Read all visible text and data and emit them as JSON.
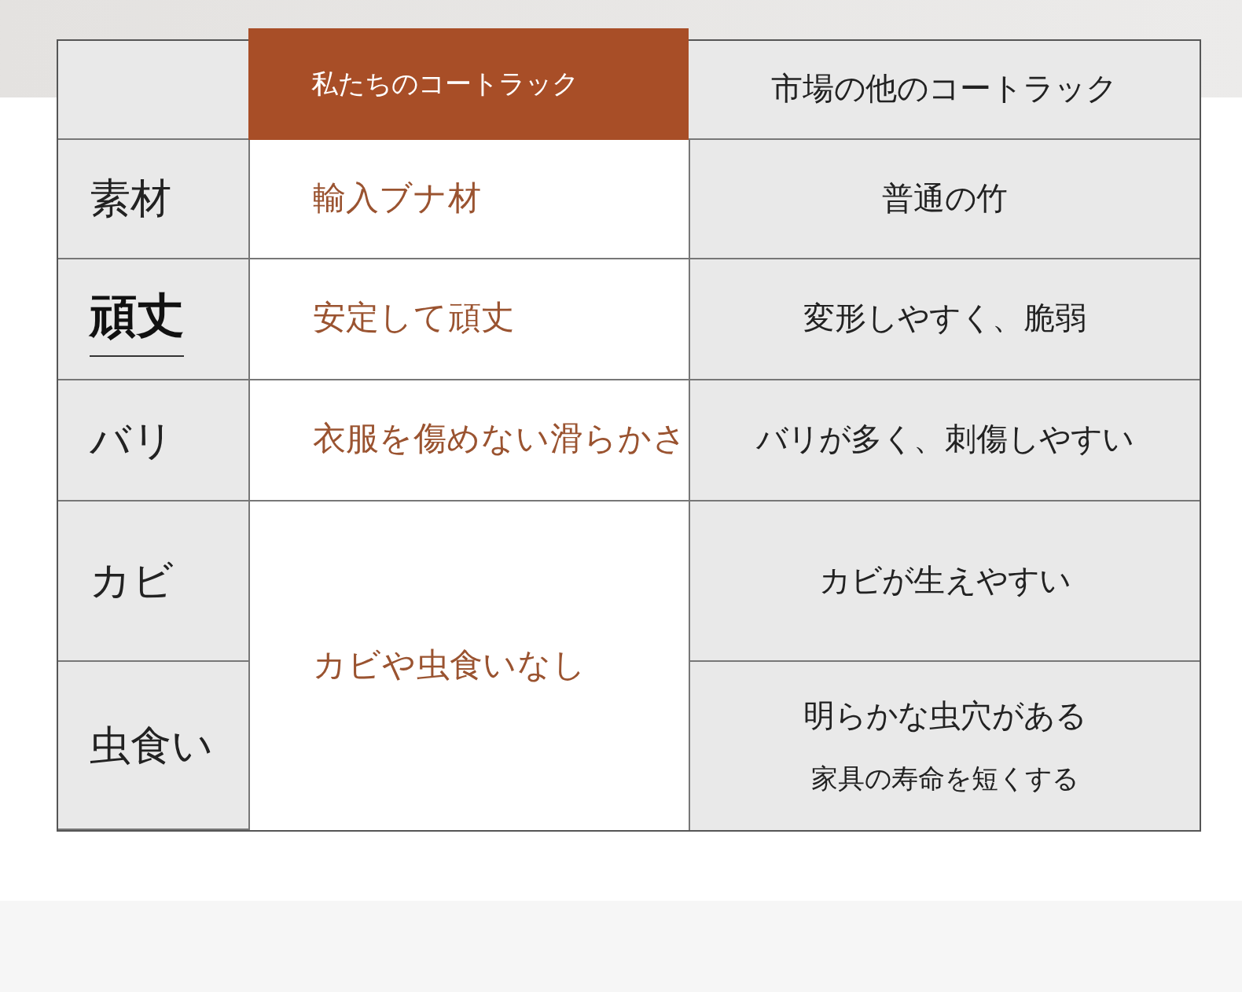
{
  "table": {
    "columns": [
      "私たちのコートラック",
      "市場の他のコートラック"
    ],
    "rows": [
      {
        "label": "素材",
        "emphasized": false,
        "ours": "輸入ブナ材",
        "others": [
          "普通の竹"
        ]
      },
      {
        "label": "頑丈",
        "emphasized": true,
        "ours": "安定して頑丈",
        "others": [
          "変形しやすく、脆弱"
        ]
      },
      {
        "label": "バリ",
        "emphasized": false,
        "ours": "衣服を傷めない滑らかさ",
        "others": [
          "バリが多く、刺傷しやすい"
        ]
      },
      {
        "label": "カビ",
        "emphasized": false,
        "ours": "カビや虫食いなし",
        "others": [
          "カビが生えやすい"
        ]
      },
      {
        "label": "虫食い",
        "emphasized": false,
        "others": [
          "明らかな虫穴がある",
          "家具の寿命を短くする"
        ]
      }
    ]
  }
}
